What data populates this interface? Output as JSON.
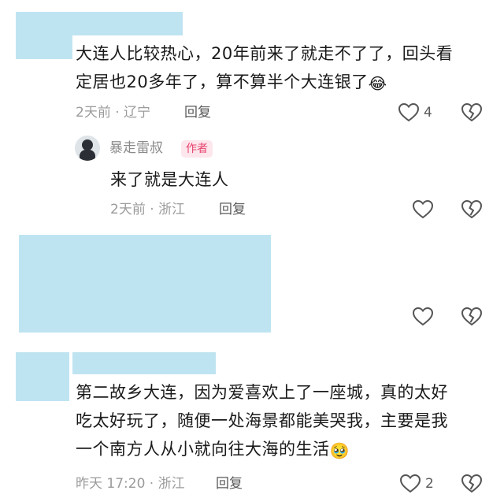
{
  "comments": [
    {
      "lines": [
        "大连人比较热心，20年前来了就走不了了，回头看",
        "定居也20多年了，算不算半个大连银了"
      ],
      "emoji": "😂",
      "meta": "2天前 · 辽宁",
      "reply_label": "回复",
      "like_count": "4"
    },
    {
      "username": "暴走雷叔",
      "badge": "作者",
      "lines": [
        "来了就是大连人"
      ],
      "meta": "2天前 · 浙江",
      "reply_label": "回复"
    },
    {
      "lines": [
        "第二故乡大连，因为爱喜欢上了一座城，真的太好",
        "吃太好玩了，随便一处海景都能美哭我，主要是我",
        "一个南方人从小就向往大海的生活"
      ],
      "emoji": "🥹",
      "meta": "昨天 17:20 · 浙江",
      "reply_label": "回复",
      "like_count": "2"
    }
  ],
  "icons": {
    "like": "heart-outline-icon",
    "dislike": "broken-heart-icon"
  },
  "colors": {
    "redaction": "#bfe4f1",
    "badge_bg": "#fde6ec",
    "badge_text": "#e8436e"
  }
}
